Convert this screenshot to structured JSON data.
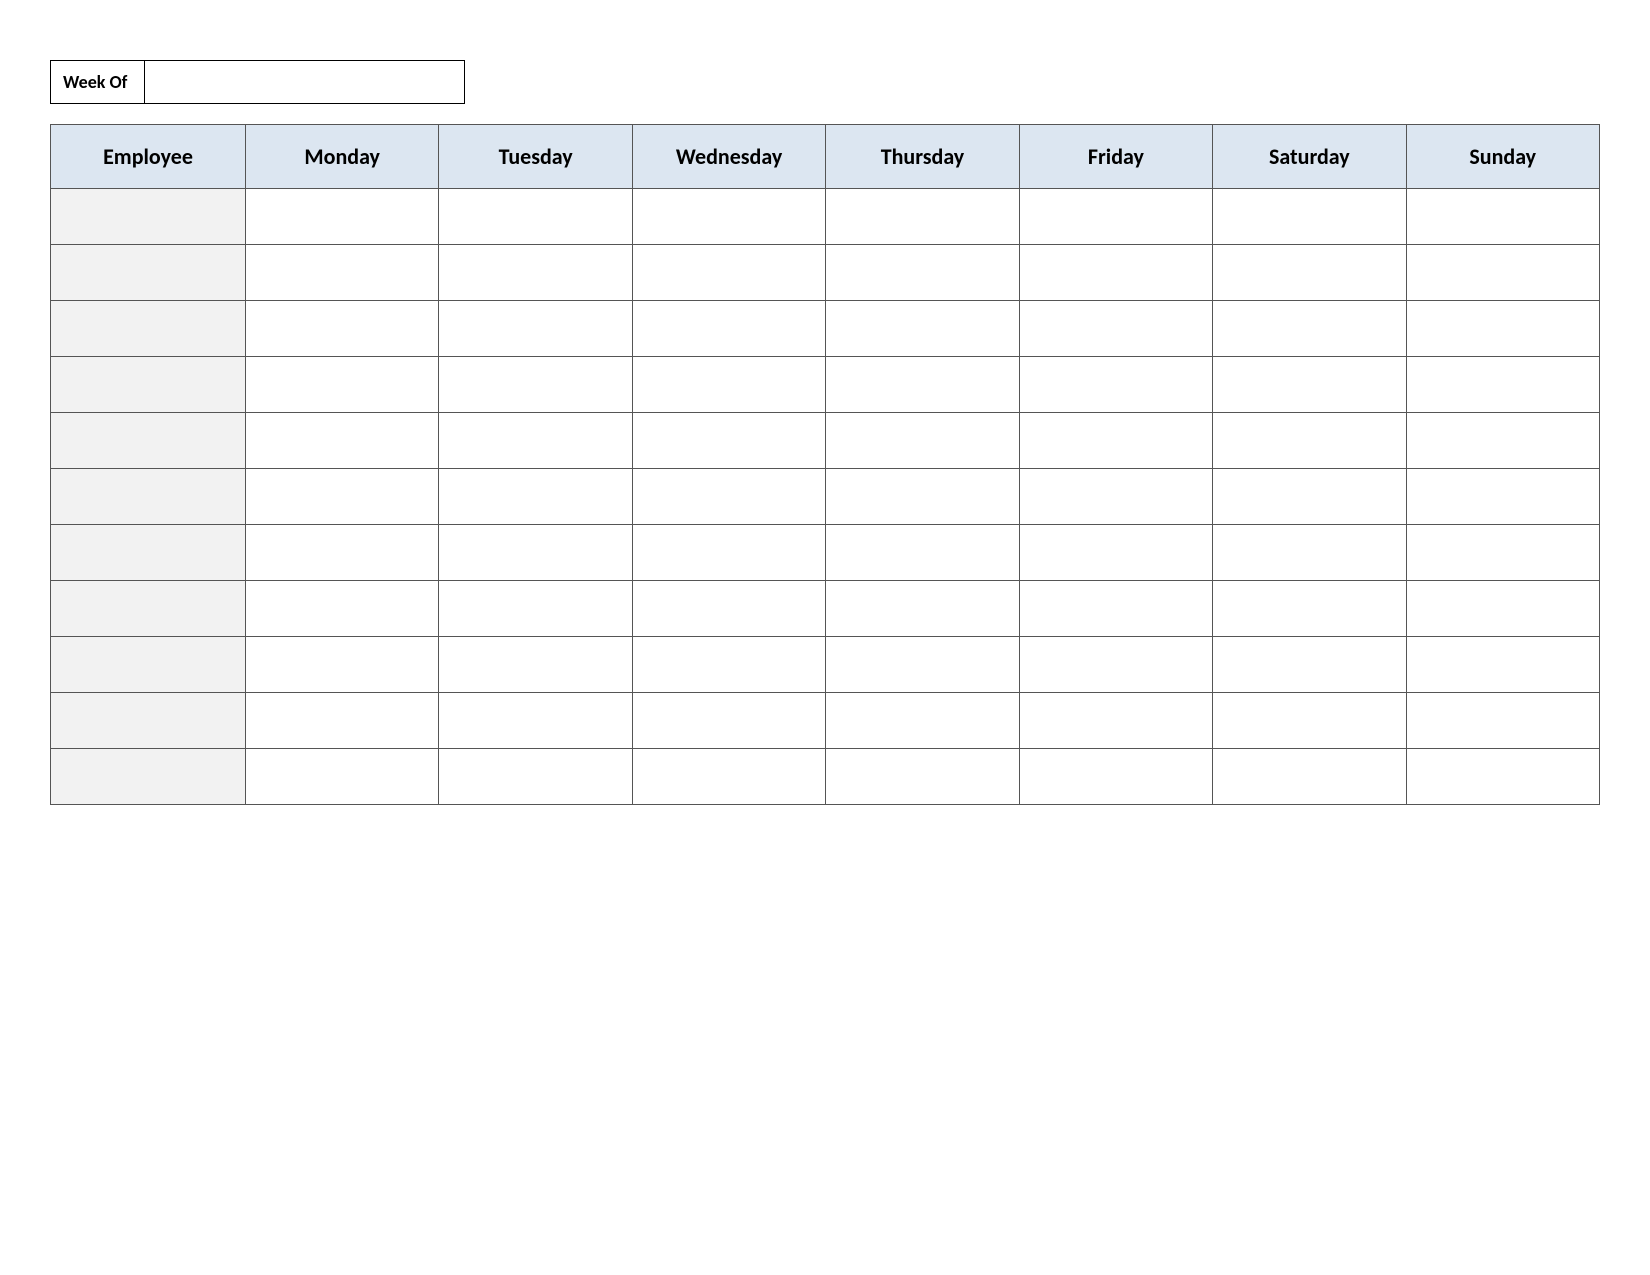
{
  "week_of": {
    "label": "Week Of",
    "value": ""
  },
  "table": {
    "headers": {
      "employee": "Employee",
      "days": [
        "Monday",
        "Tuesday",
        "Wednesday",
        "Thursday",
        "Friday",
        "Saturday",
        "Sunday"
      ]
    },
    "rows": [
      {
        "employee": "",
        "days": [
          "",
          "",
          "",
          "",
          "",
          "",
          ""
        ]
      },
      {
        "employee": "",
        "days": [
          "",
          "",
          "",
          "",
          "",
          "",
          ""
        ]
      },
      {
        "employee": "",
        "days": [
          "",
          "",
          "",
          "",
          "",
          "",
          ""
        ]
      },
      {
        "employee": "",
        "days": [
          "",
          "",
          "",
          "",
          "",
          "",
          ""
        ]
      },
      {
        "employee": "",
        "days": [
          "",
          "",
          "",
          "",
          "",
          "",
          ""
        ]
      },
      {
        "employee": "",
        "days": [
          "",
          "",
          "",
          "",
          "",
          "",
          ""
        ]
      },
      {
        "employee": "",
        "days": [
          "",
          "",
          "",
          "",
          "",
          "",
          ""
        ]
      },
      {
        "employee": "",
        "days": [
          "",
          "",
          "",
          "",
          "",
          "",
          ""
        ]
      },
      {
        "employee": "",
        "days": [
          "",
          "",
          "",
          "",
          "",
          "",
          ""
        ]
      },
      {
        "employee": "",
        "days": [
          "",
          "",
          "",
          "",
          "",
          "",
          ""
        ]
      },
      {
        "employee": "",
        "days": [
          "",
          "",
          "",
          "",
          "",
          "",
          ""
        ]
      }
    ]
  }
}
